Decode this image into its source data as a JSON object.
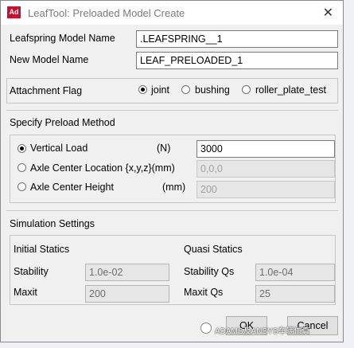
{
  "window": {
    "app_icon": "Ad",
    "title": "LeafTool: Preloaded Model Create",
    "close_glyph": "✕"
  },
  "model": {
    "leafspring_label": "Leafspring Model Name",
    "leafspring_value": ".LEAFSPRING__1",
    "new_label": "New Model Name",
    "new_value": "LEAF_PRELOADED_1"
  },
  "attachment": {
    "label": "Attachment Flag",
    "options": [
      "joint",
      "bushing",
      "roller_plate_test"
    ],
    "selected": "joint"
  },
  "preload": {
    "title": "Specify Preload Method",
    "vertical_label": "Vertical Load",
    "vertical_unit": "(N)",
    "vertical_value": "3000",
    "location_label": "Axle Center  Location {x,y,z}(mm)",
    "location_value": "0,0,0",
    "height_label": "Axle Center  Height",
    "height_unit": "(mm)",
    "height_value": "200",
    "selected": "vertical_load"
  },
  "simulation": {
    "title": "Simulation Settings",
    "initial_title": "Initial Statics",
    "stability_label": "Stability",
    "stability_value": "1.0e-02",
    "maxit_label": "Maxit",
    "maxit_value": "200",
    "quasi_title": "Quasi Statics",
    "stability_qs_label": "Stability Qs",
    "stability_qs_value": "1.0e-04",
    "maxit_qs_label": "Maxit Qs",
    "maxit_qs_value": "25"
  },
  "buttons": {
    "ok": "OK",
    "cancel": "Cancel"
  },
  "watermark": {
    "text": "ADAMS及ANSYS车辆仿真"
  },
  "colors": {
    "dialog_bg": "#f0f0f0",
    "title_bar": "#ffffff",
    "app_icon_red": "#c8102e",
    "readonly_field": "#e6e6e6"
  }
}
